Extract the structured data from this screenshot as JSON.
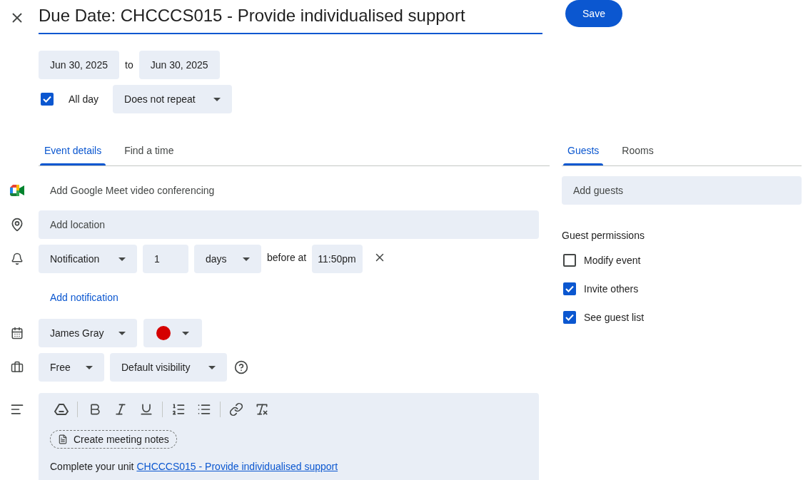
{
  "title": {
    "value": "Due Date: CHCCCS015 - Provide individualised support"
  },
  "save_button": "Save",
  "dates": {
    "start": "Jun 30, 2025",
    "separator": "to",
    "end": "Jun 30, 2025"
  },
  "all_day": {
    "label": "All day",
    "checked": true
  },
  "repeat": "Does not repeat",
  "detail_tabs": [
    {
      "label": "Event details",
      "selected": true
    },
    {
      "label": "Find a time",
      "selected": false
    }
  ],
  "conferencing": "Add Google Meet video conferencing",
  "location": {
    "placeholder": "Add location"
  },
  "notification": {
    "type": "Notification",
    "amount": "1",
    "unit": "days",
    "connector": "before at",
    "time": "11:50pm"
  },
  "add_notification": "Add notification",
  "calendar": {
    "owner": "James Gray",
    "color": "#d50000"
  },
  "availability": "Free",
  "visibility": "Default visibility",
  "description": {
    "meeting_notes": "Create meeting notes",
    "text": "Complete your unit",
    "link": "CHCCCS015 - Provide individualised support"
  },
  "side_tabs": [
    {
      "label": "Guests",
      "selected": true
    },
    {
      "label": "Rooms",
      "selected": false
    }
  ],
  "guests": {
    "placeholder": "Add guests"
  },
  "permissions": {
    "title": "Guest permissions",
    "items": [
      {
        "label": "Modify event",
        "checked": false
      },
      {
        "label": "Invite others",
        "checked": true
      },
      {
        "label": "See guest list",
        "checked": true
      }
    ]
  }
}
